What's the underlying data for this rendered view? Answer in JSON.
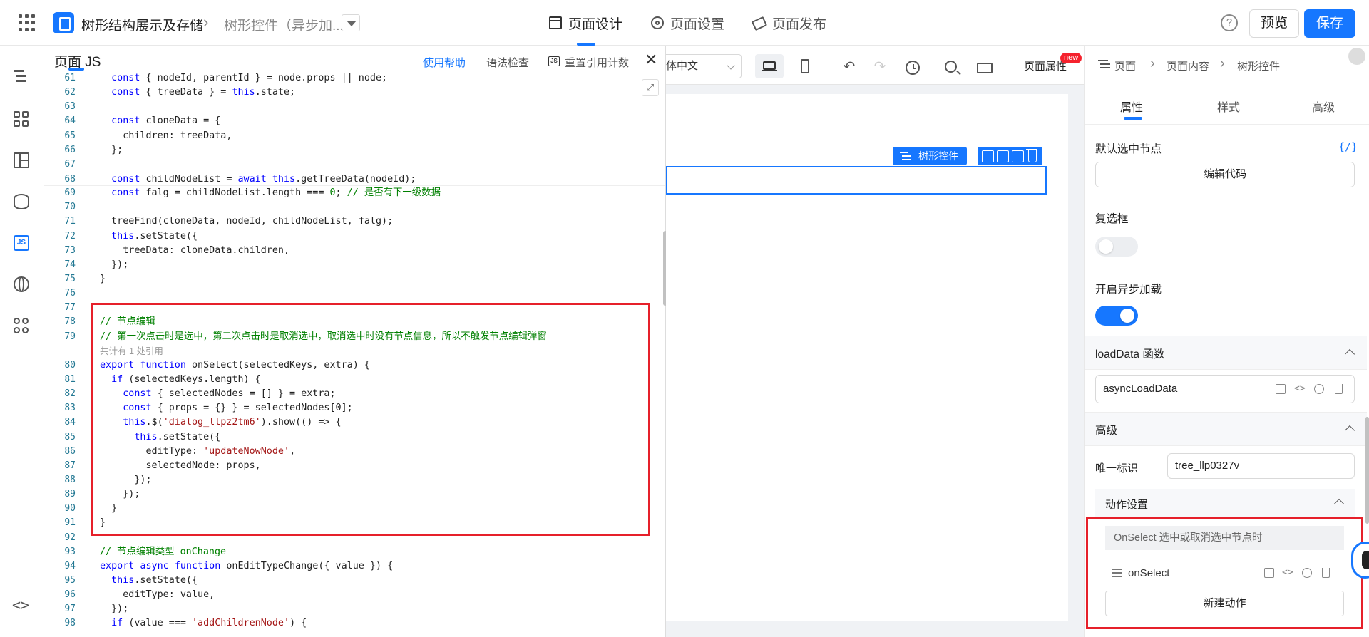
{
  "header": {
    "app_name": "树形结构展示及存储",
    "page_name": "树形控件（异步加...",
    "tabs": [
      {
        "label": "页面设计",
        "icon": "calendar-icon"
      },
      {
        "label": "页面设置",
        "icon": "gear-icon"
      },
      {
        "label": "页面发布",
        "icon": "send-icon"
      }
    ],
    "help": "?",
    "preview_label": "预览",
    "save_label": "保存"
  },
  "js_panel": {
    "title": "页面 JS",
    "help_link": "使用帮助",
    "syntax_check": "语法检查",
    "js_icon": "JS",
    "reset_refs": "重置引用计数",
    "close": "✕",
    "expand": "⤢"
  },
  "code_lines": [
    {
      "n": "61",
      "html": "  <span class='kw'>const</span> { nodeId, parentId } = node.props || node;"
    },
    {
      "n": "62",
      "html": "  <span class='kw'>const</span> { treeData } = <span class='kw'>this</span>.state;"
    },
    {
      "n": "63",
      "html": ""
    },
    {
      "n": "64",
      "html": "  <span class='kw'>const</span> cloneData = {"
    },
    {
      "n": "65",
      "html": "    children: treeData,"
    },
    {
      "n": "66",
      "html": "  };"
    },
    {
      "n": "67",
      "html": ""
    },
    {
      "n": "68",
      "html": "  <span class='kw'>const</span> childNodeList = <span class='kw'>await</span> <span class='kw'>this</span>.getTreeData(nodeId);"
    },
    {
      "n": "69",
      "html": "  <span class='kw'>const</span> falg = childNodeList.length === <span class='cm'>0</span>; <span class='cm'>// 是否有下一级数据</span>"
    },
    {
      "n": "70",
      "html": ""
    },
    {
      "n": "71",
      "html": "  treeFind(cloneData, nodeId, childNodeList, falg);"
    },
    {
      "n": "72",
      "html": "  <span class='kw'>this</span>.setState({"
    },
    {
      "n": "73",
      "html": "    treeData: cloneData.children,"
    },
    {
      "n": "74",
      "html": "  });"
    },
    {
      "n": "75",
      "html": "}"
    },
    {
      "n": "76",
      "html": ""
    },
    {
      "n": "77",
      "html": ""
    },
    {
      "n": "78",
      "html": "<span class='cm'>// 节点编辑</span>"
    },
    {
      "n": "79",
      "html": "<span class='cm'>// 第一次点击时是选中，第二次点击时是取消选中，取消选中时没有节点信息，所以不触发节点编辑弹窗</span>"
    },
    {
      "n": "",
      "hint": "共计有 1 处引用"
    },
    {
      "n": "80",
      "html": "<span class='kw'>export</span> <span class='kw'>function</span> onSelect(selectedKeys, extra) {"
    },
    {
      "n": "81",
      "html": "  <span class='kw'>if</span> (selectedKeys.length) {"
    },
    {
      "n": "82",
      "html": "    <span class='kw'>const</span> { selectedNodes = [] } = extra;"
    },
    {
      "n": "83",
      "html": "    <span class='kw'>const</span> { props = {} } = selectedNodes[0];"
    },
    {
      "n": "84",
      "html": "    <span class='kw'>this</span>.$(<span class='st'>'dialog_llpz2tm6'</span>).show(() => {"
    },
    {
      "n": "85",
      "html": "      <span class='kw'>this</span>.setState({"
    },
    {
      "n": "86",
      "html": "        editType: <span class='st'>'updateNowNode'</span>,"
    },
    {
      "n": "87",
      "html": "        selectedNode: props,"
    },
    {
      "n": "88",
      "html": "      });"
    },
    {
      "n": "89",
      "html": "    });"
    },
    {
      "n": "90",
      "html": "  }"
    },
    {
      "n": "91",
      "html": "}"
    },
    {
      "n": "92",
      "html": ""
    },
    {
      "n": "93",
      "html": "<span class='cm'>// 节点编辑类型 onChange</span>"
    },
    {
      "n": "94",
      "html": "<span class='kw'>export</span> <span class='kw'>async</span> <span class='kw'>function</span> onEditTypeChange({ value }) {"
    },
    {
      "n": "95",
      "html": "  <span class='kw'>this</span>.setState({"
    },
    {
      "n": "96",
      "html": "    editType: value,"
    },
    {
      "n": "97",
      "html": "  });"
    },
    {
      "n": "98",
      "html": "  <span class='kw'>if</span> (value === <span class='st'>'addChildrenNode'</span>) {"
    }
  ],
  "canvas": {
    "language": "体中文",
    "page_attr": "页面属性",
    "new_badge": "new",
    "undo": "↶",
    "redo": "↷",
    "tree_tag": "树形控件"
  },
  "right_panel": {
    "crumbs": [
      "页面",
      "页面内容",
      "树形控件"
    ],
    "tabs": [
      "属性",
      "样式",
      "高级"
    ],
    "default_selected_label": "默认选中节点",
    "code_icon": "{/}",
    "edit_code_btn": "编辑代码",
    "checkbox_label": "复选框",
    "checkbox_on": false,
    "async_label": "开启异步加载",
    "async_on": true,
    "loaddata_label": "loadData 函数",
    "loaddata_value": "asyncLoadData",
    "advanced_label": "高级",
    "uid_label": "唯一标识",
    "uid_value": "tree_llp0327v",
    "action_settings": "动作设置",
    "action_event": "OnSelect 选中或取消选中节点时",
    "action_name": "onSelect",
    "new_action_btn": "新建动作"
  },
  "colors": {
    "accent": "#1677ff",
    "highlight_box": "#e6202a",
    "keyword": "#0000ff",
    "comment": "#008000",
    "string": "#a31515"
  }
}
